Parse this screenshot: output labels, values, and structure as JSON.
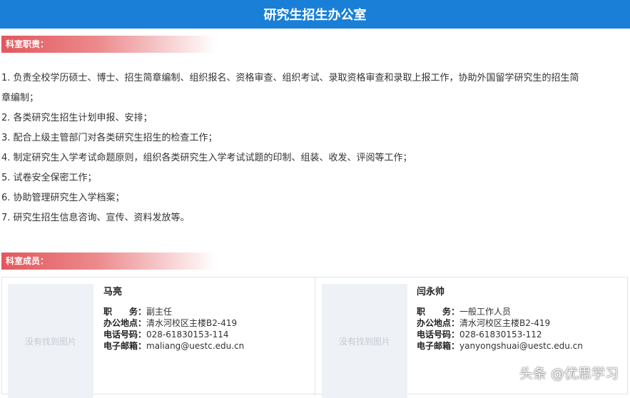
{
  "header": {
    "title": "研究生招生办公室"
  },
  "sections": {
    "duties_label": "科室职责：",
    "members_label": "科室成员："
  },
  "duties": [
    "1. 负责全校学历硕士、博士、招生简章编制、组织报名、资格审查、组织考试、录取资格审查和录取上报工作，协助外国留学研究生的招生简",
    "章编制；",
    "2. 各类研究生招生计划申报、安排；",
    "3. 配合上级主管部门对各类研究生招生的检查工作；",
    "4. 制定研究生入学考试命题原则，组织各类研究生入学考试试题的印制、组装、收发、评阅等工作；",
    "5. 试卷安全保密工作；",
    "6. 协助管理研究生入学档案；",
    "7. 研究生招生信息咨询、宣传、资料发放等。"
  ],
  "members": [
    {
      "photo_placeholder": "没有找到图片",
      "name": "马亮",
      "title_label": "职　　务：",
      "title": "副主任",
      "office_label": "办公地点：",
      "office": "清水河校区主楼B2-419",
      "phone_label": "电话号码：",
      "phone": "028-61830153-114",
      "email_label": "电子邮箱：",
      "email": "maliang@uestc.edu.cn"
    },
    {
      "photo_placeholder": "没有找到图片",
      "name": "闫永帅",
      "title_label": "职　　务：",
      "title": "一般工作人员",
      "office_label": "办公地点：",
      "office": "清水河校区主楼B2-419",
      "phone_label": "电话号码：",
      "phone": "028-61830153-112",
      "email_label": "电子邮箱：",
      "email": "yanyongshuai@uestc.edu.cn"
    }
  ],
  "watermark": "头条 @优思学习",
  "colors": {
    "header_bg": "#1a7fd6",
    "section_label": "#e2575c",
    "photo_bg": "#eef1f5"
  }
}
